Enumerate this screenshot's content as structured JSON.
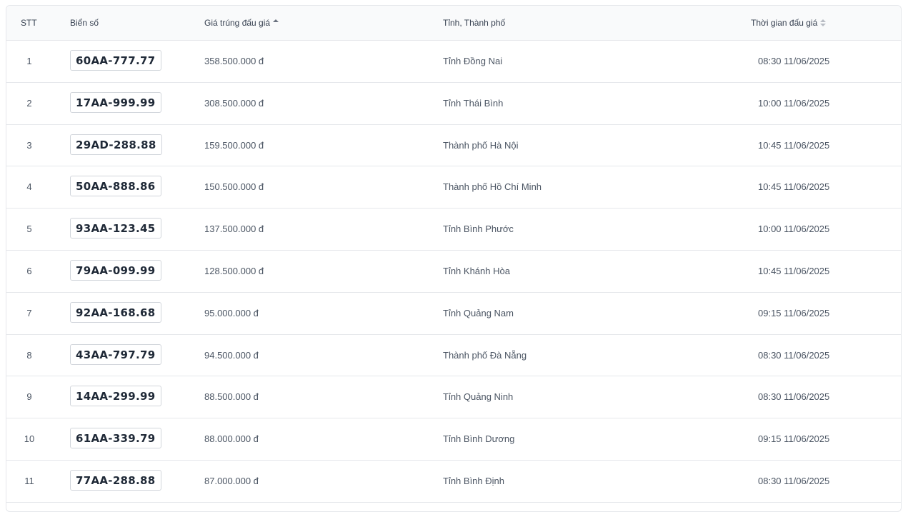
{
  "table": {
    "headers": {
      "stt": "STT",
      "plate": "Biển số",
      "price": "Giá trúng đấu giá",
      "province": "Tỉnh, Thành phố",
      "time": "Thời gian đấu giá"
    },
    "sort": {
      "price": "ascending-active",
      "time": "unsorted"
    },
    "rows": [
      {
        "stt": "1",
        "plate": "60AA-777.77",
        "price": "358.500.000 đ",
        "province": "Tỉnh Đồng Nai",
        "time": "08:30 11/06/2025"
      },
      {
        "stt": "2",
        "plate": "17AA-999.99",
        "price": "308.500.000 đ",
        "province": "Tỉnh Thái Bình",
        "time": "10:00 11/06/2025"
      },
      {
        "stt": "3",
        "plate": "29AD-288.88",
        "price": "159.500.000 đ",
        "province": "Thành phố Hà Nội",
        "time": "10:45 11/06/2025"
      },
      {
        "stt": "4",
        "plate": "50AA-888.86",
        "price": "150.500.000 đ",
        "province": "Thành phố Hồ Chí Minh",
        "time": "10:45 11/06/2025"
      },
      {
        "stt": "5",
        "plate": "93AA-123.45",
        "price": "137.500.000 đ",
        "province": "Tỉnh Bình Phước",
        "time": "10:00 11/06/2025"
      },
      {
        "stt": "6",
        "plate": "79AA-099.99",
        "price": "128.500.000 đ",
        "province": "Tỉnh Khánh Hòa",
        "time": "10:45 11/06/2025"
      },
      {
        "stt": "7",
        "plate": "92AA-168.68",
        "price": "95.000.000 đ",
        "province": "Tỉnh Quảng Nam",
        "time": "09:15 11/06/2025"
      },
      {
        "stt": "8",
        "plate": "43AA-797.79",
        "price": "94.500.000 đ",
        "province": "Thành phố Đà Nẵng",
        "time": "08:30 11/06/2025"
      },
      {
        "stt": "9",
        "plate": "14AA-299.99",
        "price": "88.500.000 đ",
        "province": "Tỉnh Quảng Ninh",
        "time": "08:30 11/06/2025"
      },
      {
        "stt": "10",
        "plate": "61AA-339.79",
        "price": "88.000.000 đ",
        "province": "Tỉnh Bình Dương",
        "time": "09:15 11/06/2025"
      },
      {
        "stt": "11",
        "plate": "77AA-288.88",
        "price": "87.000.000 đ",
        "province": "Tỉnh Bình Định",
        "time": "08:30 11/06/2025"
      }
    ]
  }
}
